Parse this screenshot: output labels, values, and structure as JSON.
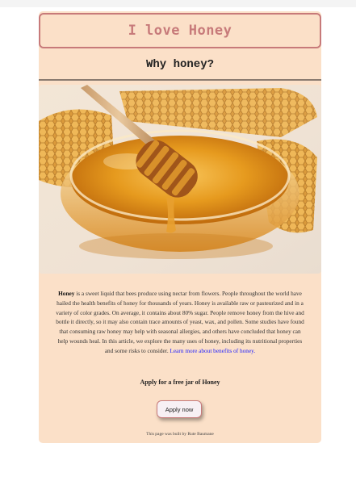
{
  "header": {
    "title": "I love Honey"
  },
  "section": {
    "heading": "Why honey?"
  },
  "hero": {
    "image_subject": "honey-dipper-in-bowl-with-honeycomb"
  },
  "article": {
    "bold_term": "Honey",
    "body": " is a sweet liquid that bees produce using nectar from flowers. People throughout the world have hailed the health benefits of honey for thousands of years. Honey is available raw or pasteurized and in a variety of color grades. On average, it contains about 80% sugar. People remove honey from the hive and bottle it directly, so it may also contain trace amounts of yeast, wax, and pollen. Some studies have found that consuming raw honey may help with seasonal allergies, and others have concluded that honey can help wounds heal. In this article, we explore the many uses of honey, including its nutritional properties and some risks to consider. ",
    "link_text": "Learn more about benefits of honey."
  },
  "apply": {
    "heading": "Apply for a free jar of Honey",
    "button_label": "Apply now"
  },
  "footer": {
    "text": "This page was built by Rute Baumane"
  },
  "colors": {
    "card_background": "#fbe0c8",
    "accent": "#c77a7a",
    "link": "#1a1aff"
  }
}
